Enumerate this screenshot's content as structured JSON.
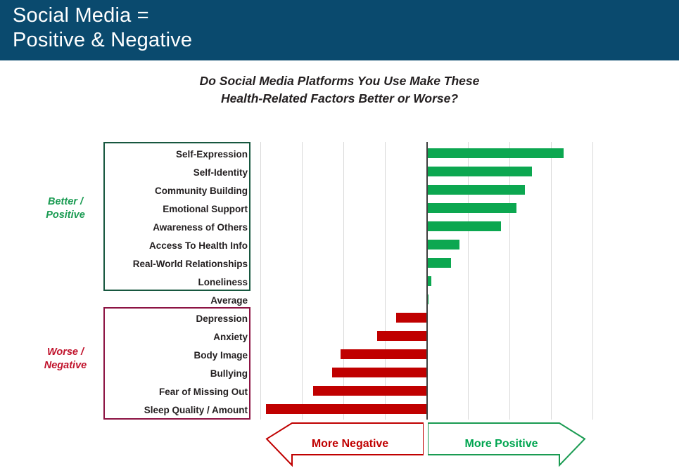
{
  "banner": {
    "title": "Social Media =\nPositive & Negative",
    "background_color": "#0a4a6e",
    "text_color": "#ffffff"
  },
  "chart_title": "Do Social Media Platforms You Use Make These\nHealth-Related Factors Better or Worse?",
  "groups": {
    "positive": {
      "label": "Better /\nPositive",
      "color": "#1a9b52",
      "box_border_color": "#17573f"
    },
    "negative": {
      "label": "Worse /\nNegative",
      "color": "#c0122b",
      "box_border_color": "#8c1343"
    }
  },
  "legend": {
    "negative": {
      "label": "More Negative",
      "color": "#c00000",
      "direction": "left"
    },
    "positive": {
      "label": "More Positive",
      "color": "#00a550",
      "direction": "right"
    }
  },
  "chart_data": {
    "type": "bar",
    "orientation": "horizontal",
    "title": "Do Social Media Platforms You Use Make These Health-Related Factors Better or Worse?",
    "xlabel": "",
    "ylabel": "",
    "xlim": [
      -4.0,
      4.0
    ],
    "grid": true,
    "gridline_step": 1.0,
    "legend_position": "bottom",
    "zero_axis": 0,
    "bar_colors": {
      "positive": "#0ca750",
      "negative": "#c00000"
    },
    "categories": [
      "Self-Expression",
      "Self-Identity",
      "Community Building",
      "Emotional Support",
      "Awareness of Others",
      "Access To Health Info",
      "Real-World Relationships",
      "Loneliness",
      "Average",
      "Depression",
      "Anxiety",
      "Body Image",
      "Bullying",
      "Fear of Missing Out",
      "Sleep Quality / Amount"
    ],
    "values": [
      3.3,
      2.55,
      2.38,
      2.17,
      1.8,
      0.8,
      0.59,
      0.12,
      0.05,
      -0.73,
      -1.19,
      -2.07,
      -2.27,
      -2.73,
      -3.86
    ],
    "group_assignment": [
      "positive",
      "positive",
      "positive",
      "positive",
      "positive",
      "positive",
      "positive",
      "positive",
      "average",
      "negative",
      "negative",
      "negative",
      "negative",
      "negative",
      "negative"
    ]
  }
}
